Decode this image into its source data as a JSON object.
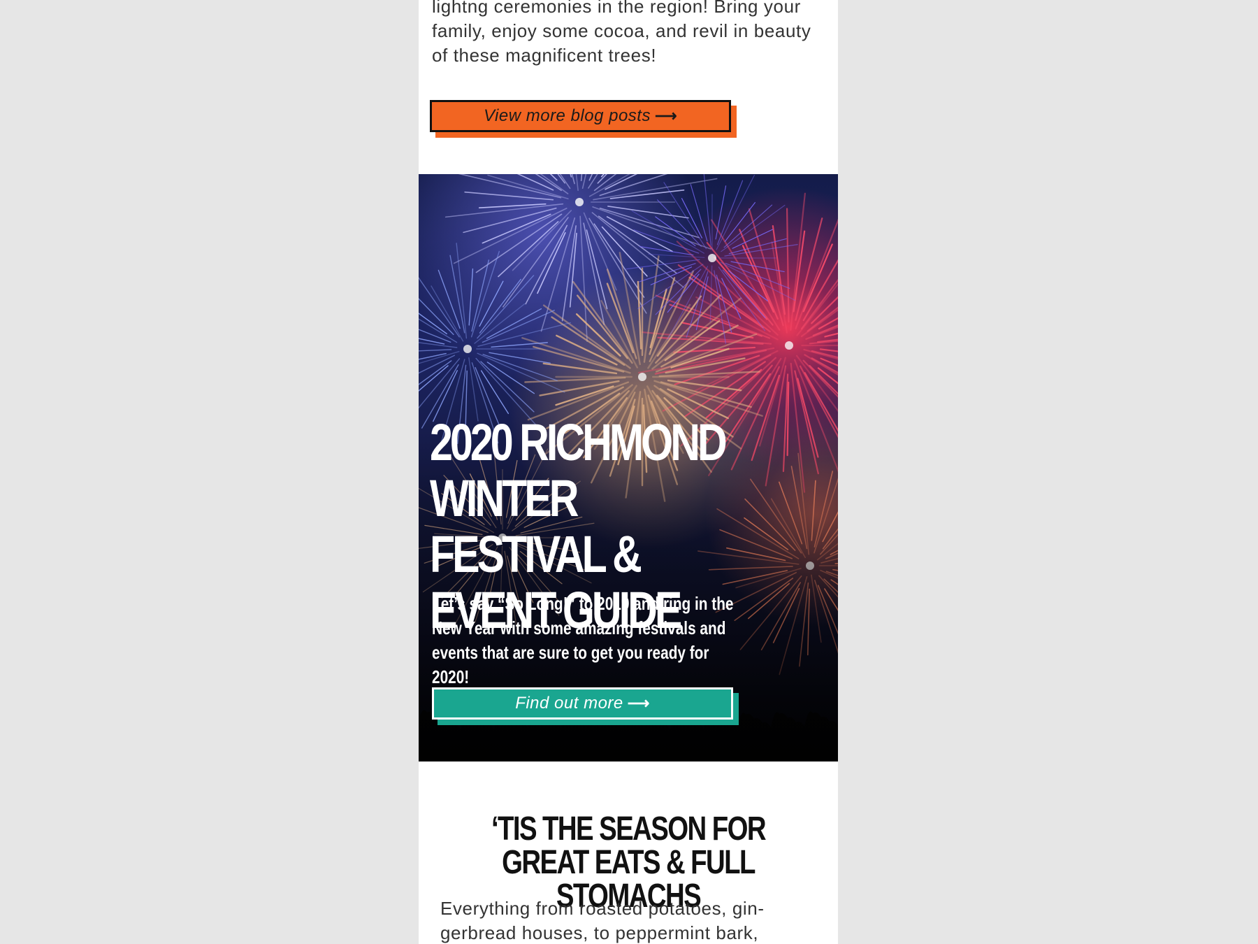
{
  "intro": {
    "text": "lightng ceremonies in the region! Bring your family, enjoy some cocoa, and revil in beauty of these magnificent trees!"
  },
  "blog_button": {
    "label": "View more blog posts",
    "icon": "arrow-right-icon",
    "color": "#f26522"
  },
  "hero": {
    "image": "fireworks-photo",
    "title": "2020 Richmond Winter Festival & Event Guide",
    "body": "Let’s say “So Long!” to 2019 and ring in the New Year with some amazing festivals and events that are sure to get you ready for 2020!",
    "button": {
      "label": "Find out more",
      "icon": "arrow-right-icon",
      "color": "#1aa690"
    }
  },
  "eats": {
    "title": "‘Tis the season for great eats & full stomachs",
    "body": "Everything from roasted potatoes, gin- gerbread houses, to peppermint bark,"
  },
  "colors": {
    "background": "#e6e6e6",
    "page": "#ffffff",
    "text": "#333333"
  }
}
